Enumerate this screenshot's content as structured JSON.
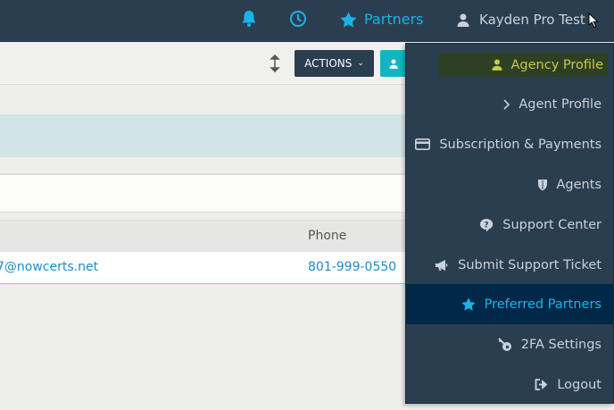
{
  "navbar": {
    "partners_label": "Partners",
    "user_label": "Kayden Pro Test",
    "accent_color": "#1ab3e8",
    "background_color": "#2b3e50"
  },
  "toolbar": {
    "actions_label": "ACTIONS"
  },
  "table": {
    "headers": [
      "Phone"
    ],
    "rows": [
      {
        "email": "7@nowcerts.net",
        "phone": "801-999-0550"
      }
    ]
  },
  "user_menu": {
    "items": [
      {
        "label": "Agency Profile",
        "icon": "user-icon",
        "state": "hover"
      },
      {
        "label": "Agent Profile",
        "icon": "chevron-right-icon"
      },
      {
        "label": "Subscription & Payments",
        "icon": "credit-card-icon"
      },
      {
        "label": "Agents",
        "icon": "shield-icon"
      },
      {
        "label": "Support Center",
        "icon": "question-bubble-icon"
      },
      {
        "label": "Submit Support Ticket",
        "icon": "megaphone-icon"
      },
      {
        "label": "Preferred Partners",
        "icon": "star-icon",
        "state": "active"
      },
      {
        "label": "2FA Settings",
        "icon": "key-icon"
      },
      {
        "label": "Logout",
        "icon": "sign-out-icon"
      }
    ],
    "active_color": "#012947",
    "hover_color": "#2e4023"
  }
}
